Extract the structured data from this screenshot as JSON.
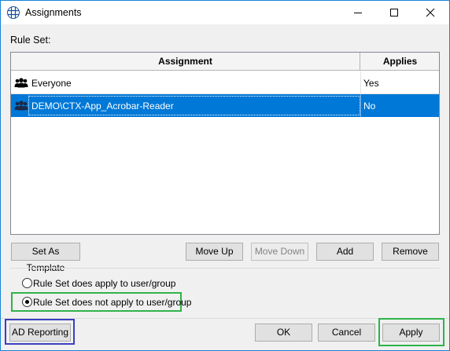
{
  "window": {
    "title": "Assignments",
    "icon": "globe-grid-icon"
  },
  "ruleset": {
    "label": "Rule Set:"
  },
  "grid": {
    "columns": [
      "Assignment",
      "Applies"
    ],
    "rows": [
      {
        "name": "Everyone",
        "applies": "Yes",
        "icon": "group-icon",
        "selected": false
      },
      {
        "name": "DEMO\\CTX-App_Acrobar-Reader",
        "applies": "No",
        "icon": "group-icon",
        "selected": true
      }
    ]
  },
  "buttons": {
    "set_as_template": "Set As Template",
    "move_up": "Move Up",
    "move_down": "Move Down",
    "add": "Add",
    "remove": "Remove",
    "ad_reporting": "AD Reporting",
    "ok": "OK",
    "cancel": "Cancel",
    "apply": "Apply"
  },
  "options": [
    {
      "label": "Rule Set does apply to user/group",
      "checked": false
    },
    {
      "label": "Rule Set does not apply to user/group",
      "checked": true
    }
  ],
  "colors": {
    "selection": "#0078d7",
    "highlight_green": "#2fb34a",
    "highlight_blue": "#3b3fbf"
  }
}
